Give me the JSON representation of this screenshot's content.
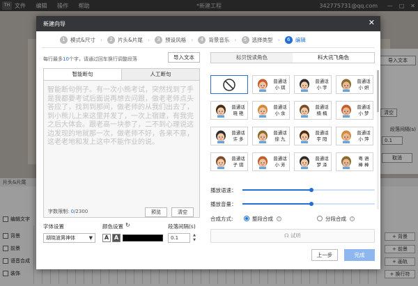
{
  "app": {
    "logo": "TH",
    "menu": [
      "文件",
      "编辑",
      "操作",
      "帮助"
    ],
    "title": "*新建工程",
    "user": "342775731@qq.com",
    "win_controls": [
      "—",
      "□",
      "✕"
    ]
  },
  "background": {
    "import_text": "导入文本",
    "clear": "清空",
    "para_spacing": "段落间隔(s)",
    "para_value": "0.1",
    "cancel": "取消",
    "tl_head": "片头&片尾",
    "tracks": [
      "编辑文字",
      "背景",
      "前景",
      "语音合成",
      "装饰"
    ],
    "add_buttons": [
      "+ 背景",
      "+ 前景",
      "+ 画轨",
      "+ 换行符"
    ]
  },
  "modal": {
    "title": "新建向导",
    "close": "✕",
    "steps": [
      {
        "num": "1",
        "label": "模式&尺寸"
      },
      {
        "num": "2",
        "label": "片头&片尾"
      },
      {
        "num": "3",
        "label": "预设风格"
      },
      {
        "num": "4",
        "label": "背景音乐"
      },
      {
        "num": "5",
        "label": "选择类型"
      },
      {
        "num": "6",
        "label": "编辑"
      }
    ],
    "hint_prefix": "每行最多",
    "hint_num": "10",
    "hint_suffix": "个字，请通过回车换行调整段落",
    "import_btn": "导入文本",
    "editor_tabs": [
      "智能断句",
      "人工断句"
    ],
    "editor_text": "智能断句例子。有一次小熊考试，突然找到了手是我都要考试后面说再想去问跟，做老老师点头答应了，找到到那间，做老师的从我们出去了，到小熊儿上来这里并发了，一次上宿建，有我完之后大体会。跟老高一块参了，二不到心理说这边发现的地就那一次，做老师不好，各来不意，这老老地和发上这中不能作业的说。",
    "char_label": "字数限制: ",
    "char_current": "0",
    "char_max": "/2300",
    "btn_preview": "预览",
    "btn_clear": "清空",
    "font_label": "字体设置",
    "font_value": "胡晓波男神体",
    "color_label": "颜色设置",
    "color_a1": "A",
    "color_a2": "A",
    "color_value": "#000000",
    "para_label": "段落间隔(s)",
    "para_value": "0.1",
    "role_tabs": [
      "标贝悦读角色",
      "科大讯飞角色"
    ],
    "voices": [
      {
        "line1": "",
        "line2": ""
      },
      {
        "line1": "普通话",
        "line2": "小 琪"
      },
      {
        "line1": "普通话",
        "line2": "小 宇"
      },
      {
        "line1": "普通话",
        "line2": "小 妍"
      },
      {
        "line1": "普通话",
        "line2": "晓 艳"
      },
      {
        "line1": "普通话",
        "line2": "小 余"
      },
      {
        "line1": "普通话",
        "line2": "楠 楠"
      },
      {
        "line1": "普通话",
        "line2": "小 梦"
      },
      {
        "line1": "普通话",
        "line2": "许 多"
      },
      {
        "line1": "普通话",
        "line2": "徐 九"
      },
      {
        "line1": "普通话",
        "line2": "宇 阳"
      },
      {
        "line1": "普通话",
        "line2": "小 萍"
      },
      {
        "line1": "普通话",
        "line2": "子 琪"
      },
      {
        "line1": "普通话",
        "line2": "小 芳"
      },
      {
        "line1": "普通话",
        "line2": "梦 泽"
      },
      {
        "line1": "粤 语",
        "line2": "棒 棒"
      }
    ],
    "speed_label": "播放语速：",
    "speed_value": 0.52,
    "volume_label": "播放音量：",
    "volume_value": 0.52,
    "synth_label": "合成方式:",
    "synth_opt1": "整段合成",
    "synth_opt2": "分段合成",
    "listen": "试听",
    "prev": "上一步",
    "done": "完成"
  }
}
